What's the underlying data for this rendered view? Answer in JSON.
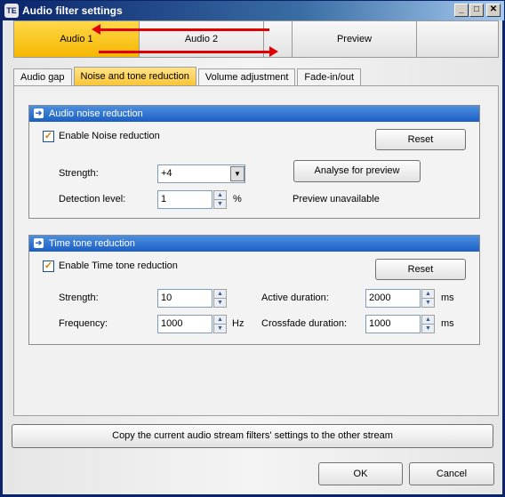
{
  "window": {
    "title": "Audio filter settings",
    "icon": "app-logo-icon"
  },
  "titlebar_buttons": {
    "minimize": "_",
    "maximize": "□",
    "close": "✕"
  },
  "audio_tabs": [
    {
      "label": "Audio 1",
      "active": true
    },
    {
      "label": "Audio 2",
      "active": false
    },
    {
      "label": "",
      "active": false
    },
    {
      "label": "Preview",
      "active": false
    },
    {
      "label": "",
      "active": false
    }
  ],
  "panel_tabs": [
    {
      "label": "Audio gap"
    },
    {
      "label": "Noise and tone reduction",
      "active": true
    },
    {
      "label": "Volume adjustment"
    },
    {
      "label": "Fade-in/out"
    }
  ],
  "noise": {
    "header": "Audio noise reduction",
    "enable_label": "Enable Noise reduction",
    "enable_checked": "✓",
    "reset_label": "Reset",
    "strength_label": "Strength:",
    "strength_value": "+4",
    "analyse_label": "Analyse for preview",
    "detection_label": "Detection level:",
    "detection_value": "1",
    "detection_unit": "%",
    "preview_status": "Preview unavailable"
  },
  "tone": {
    "header": "Time tone reduction",
    "enable_label": "Enable Time tone reduction",
    "enable_checked": "✓",
    "reset_label": "Reset",
    "strength_label": "Strength:",
    "strength_value": "10",
    "frequency_label": "Frequency:",
    "frequency_value": "1000",
    "frequency_unit": "Hz",
    "active_label": "Active duration:",
    "active_value": "2000",
    "active_unit": "ms",
    "crossfade_label": "Crossfade duration:",
    "crossfade_value": "1000",
    "crossfade_unit": "ms"
  },
  "copy_button": "Copy the current audio stream filters' settings to the other stream",
  "ok_button": "OK",
  "cancel_button": "Cancel",
  "colors": {
    "accent_active_tab": "#f5b700",
    "group_header": "#1c5fc5",
    "annotation_arrow": "#e00000"
  }
}
